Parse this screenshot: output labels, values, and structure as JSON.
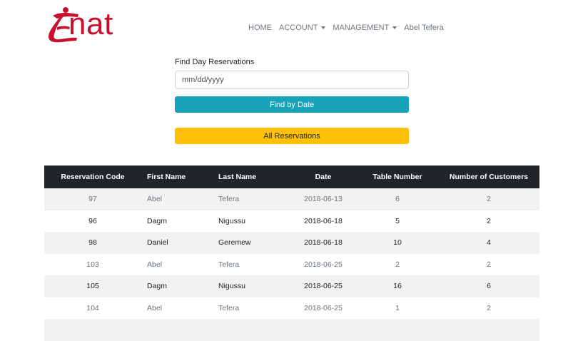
{
  "brand": {
    "logo_text": "nat",
    "colors": {
      "brand": "#c8102e"
    }
  },
  "nav": {
    "home": "HOME",
    "account": "ACCOUNT",
    "management": "MANAGEMENT",
    "user": "Abel Tefera"
  },
  "search": {
    "label": "Find Day Reservations",
    "placeholder": "mm/dd/yyyy",
    "value": "",
    "find_button": "Find by Date",
    "all_button": "All Reservations"
  },
  "table": {
    "headers": [
      "Reservation Code",
      "First Name",
      "Last Name",
      "Date",
      "Table Number",
      "Number of Customers"
    ],
    "rows": [
      [
        "97",
        "Abel",
        "Tefera",
        "2018-06-13",
        "6",
        "2"
      ],
      [
        "96",
        "Dagm",
        "Nigussu",
        "2018-06-18",
        "5",
        "2"
      ],
      [
        "98",
        "Daniel",
        "Geremew",
        "2018-06-18",
        "10",
        "4"
      ],
      [
        "103",
        "Abel",
        "Tefera",
        "2018-06-25",
        "2",
        "2"
      ],
      [
        "105",
        "Dagm",
        "Nigussu",
        "2018-06-25",
        "16",
        "6"
      ],
      [
        "104",
        "Abel",
        "Tefera",
        "2018-06-25",
        "1",
        "2"
      ]
    ]
  },
  "colors": {
    "info": "#17a2b8",
    "warning": "#ffc107",
    "table_header": "#212529",
    "stripe": "#f2f2f2"
  }
}
